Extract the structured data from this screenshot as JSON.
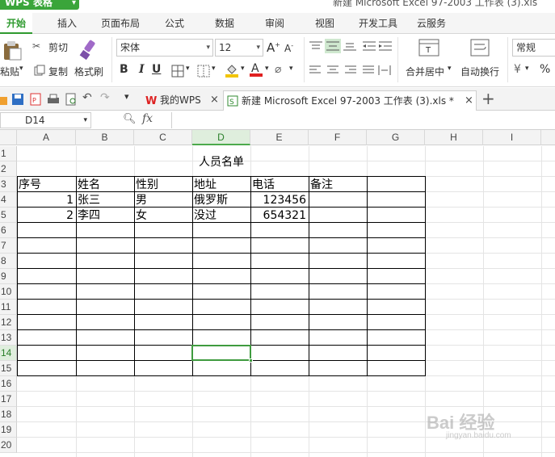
{
  "app": {
    "name": "WPS 表格",
    "document_title": "新建 Microsoft Excel 97-2003 工作表 (3).xls"
  },
  "menu": {
    "tabs": [
      "开始",
      "插入",
      "页面布局",
      "公式",
      "数据",
      "审阅",
      "视图",
      "开发工具",
      "云服务"
    ],
    "active": "开始"
  },
  "ribbon": {
    "paste_label": "粘贴",
    "cut_label": "剪切",
    "copy_label": "复制",
    "format_painter_label": "格式刷",
    "font_name": "宋体",
    "font_size": "12",
    "bold": "B",
    "italic": "I",
    "underline": "U",
    "merge_center_label": "合并居中",
    "wrap_text_label": "自动换行",
    "number_format": "常规",
    "percent": "%"
  },
  "doc_tabs": [
    {
      "label": "我的WPS"
    },
    {
      "label": "新建 Microsoft Excel 97-2003 工作表 (3).xls *"
    }
  ],
  "formula_bar": {
    "cell_ref": "D14",
    "fx": "fx",
    "value": ""
  },
  "sheet": {
    "columns": [
      "A",
      "B",
      "C",
      "D",
      "E",
      "F",
      "G",
      "H",
      "I"
    ],
    "selected_column": "D",
    "rows": [
      "1",
      "2",
      "3",
      "4",
      "5",
      "6",
      "7",
      "8",
      "9",
      "10",
      "11",
      "12",
      "13",
      "14",
      "15",
      "16",
      "17",
      "18",
      "19",
      "20"
    ],
    "selected_row": "14",
    "title": "人员名单",
    "headers": [
      "序号",
      "姓名",
      "性别",
      "地址",
      "电话",
      "备注"
    ],
    "records": [
      {
        "no": "1",
        "name": "张三",
        "gender": "男",
        "address": "俄罗斯",
        "phone": "123456",
        "note": ""
      },
      {
        "no": "2",
        "name": "李四",
        "gender": "女",
        "address": "没过",
        "phone": "654321",
        "note": ""
      }
    ]
  },
  "watermark": {
    "text": "Bai 经验",
    "sub": "jingyan.baidu.com"
  },
  "colors": {
    "accent": "#3aa53a",
    "selection": "#3f9b3f",
    "header_bg": "#f3f3f3"
  }
}
